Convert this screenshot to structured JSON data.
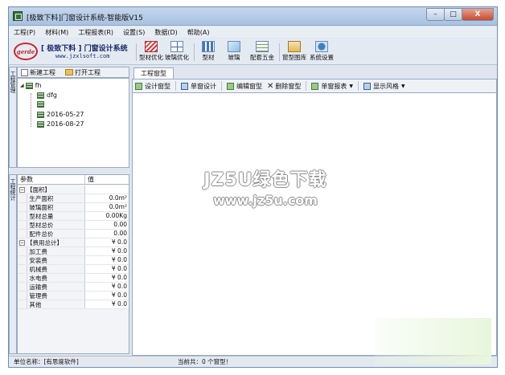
{
  "window": {
    "title": "[极致下料]门窗设计系统-智能版V15",
    "controls": {
      "minimize": "–",
      "maximize": "□",
      "close": "X"
    }
  },
  "menu": [
    "工程(P)",
    "材料(M)",
    "工程报表(R)",
    "设置(S)",
    "数据(D)",
    "帮助(A)"
  ],
  "logo": {
    "mark": "gerde",
    "name": "[ 极致下料 ] 门窗设计系统",
    "url": "www.jzxlsoft.com"
  },
  "toolbar": [
    {
      "label": "型材优化",
      "icon": "profile-optimize-icon"
    },
    {
      "label": "玻璃优化",
      "icon": "glass-optimize-icon"
    },
    {
      "label": "型材",
      "icon": "profile-icon"
    },
    {
      "label": "玻璃",
      "icon": "glass-icon"
    },
    {
      "label": "配套五金",
      "icon": "hardware-icon"
    },
    {
      "label": "窗型图库",
      "icon": "window-library-icon"
    },
    {
      "label": "系统设置",
      "icon": "system-settings-icon"
    }
  ],
  "project_panel": {
    "side_tab": "工程管理",
    "new_project": "新建工程",
    "open_project": "打开工程",
    "tree": {
      "root": "fh",
      "children": [
        "dfg",
        "",
        "2016-05-27",
        "2016-08-27"
      ]
    }
  },
  "stats_panel": {
    "side_tab": "工程统计",
    "headers": {
      "param": "参数",
      "value": "值"
    },
    "area_group": "【面积】",
    "area_rows": [
      {
        "label": "生产面积",
        "value": "0.0m²"
      },
      {
        "label": "玻璃面积",
        "value": "0.0m²"
      },
      {
        "label": "型材总量",
        "value": "0.00Kg"
      },
      {
        "label": "型材总价",
        "value": "0.00"
      },
      {
        "label": "配件总价",
        "value": "0.00"
      }
    ],
    "cost_group": "【费用总计】",
    "cost_group_value": "¥ 0.0",
    "cost_rows": [
      {
        "label": "加工费",
        "value": "¥ 0.0"
      },
      {
        "label": "安装费",
        "value": "¥ 0.0"
      },
      {
        "label": "机械费",
        "value": "¥ 0.0"
      },
      {
        "label": "水电费",
        "value": "¥ 0.0"
      },
      {
        "label": "运输费",
        "value": "¥ 0.0"
      },
      {
        "label": "管理费",
        "value": "¥ 0.0"
      },
      {
        "label": "其他",
        "value": "¥ 0.0"
      }
    ]
  },
  "doc": {
    "tab": "工程窗型",
    "actions": {
      "design": "设计窗型",
      "single": "单窗设计",
      "edit": "编辑窗型",
      "delete": "删除窗型",
      "report": "单窗报表",
      "style": "显示风格"
    }
  },
  "watermark": {
    "line1": "JZ5U绿色下载",
    "line2": "www.jz5u.com"
  },
  "status": {
    "unit": "单位名称：[有思度软件]",
    "count": "当前共：0 个窗型！"
  }
}
